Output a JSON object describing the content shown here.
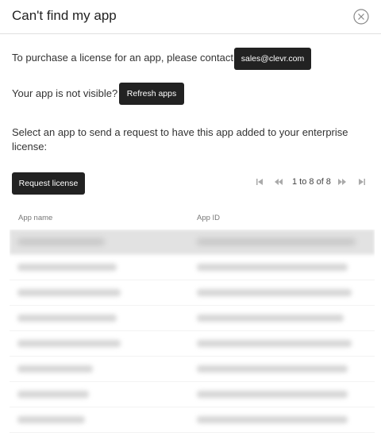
{
  "dialog": {
    "title": "Can't find my app"
  },
  "contact": {
    "text": "To purchase a license for an app, please contact",
    "email_button": "sales@clevr.com"
  },
  "visibility": {
    "text": "Your app is not visible?",
    "refresh_button": "Refresh apps"
  },
  "request": {
    "description": "Select an app to send a request to have this app added to your enterprise license:",
    "button": "Request license"
  },
  "pagination": {
    "range_text": "1 to 8 of 8"
  },
  "table": {
    "columns": [
      "App name",
      "App ID"
    ],
    "rows_visible": 8,
    "rows_obscured": true
  },
  "colors": {
    "button_bg": "#222222",
    "button_text": "#ffffff",
    "row_highlight": "#e2e2e2"
  }
}
